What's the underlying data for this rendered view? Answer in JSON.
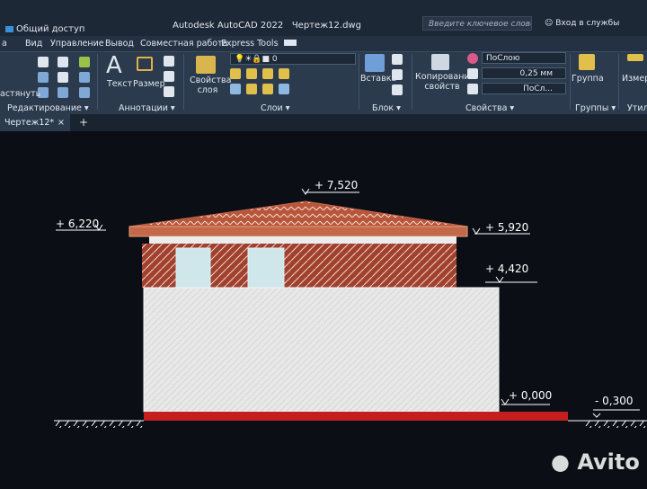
{
  "titlebar": {
    "share_label": "Общий доступ",
    "app_name": "Autodesk AutoCAD 2022",
    "file_name": "Чертеж12.dwg",
    "search_placeholder": "Введите ключевое слово/фразу",
    "signin_label": "Вход в службы"
  },
  "menu": [
    "а",
    "Вид",
    "Управление",
    "Вывод",
    "Совместная работа",
    "Express Tools"
  ],
  "ribbon": {
    "modify": {
      "stretch_label": "астянуть",
      "panel_label": "Редактирование ▾"
    },
    "annotation": {
      "text_label": "Текст",
      "dim_label": "Размер",
      "panel_label": "Аннотации ▾"
    },
    "layers": {
      "props_label": "Свойства слоя",
      "layer_value": "0",
      "panel_label": "Слои ▾"
    },
    "block": {
      "insert_label": "Вставка",
      "panel_label": "Блок ▾"
    },
    "properties": {
      "match_label": "Копирование свойств",
      "color_value": "ПоСлою",
      "lineweight_value": "0,25 мм",
      "linetype_value": "ПоСл...",
      "panel_label": "Свойства ▾"
    },
    "groups": {
      "group_label": "Группа",
      "panel_label": "Группы ▾"
    },
    "measure": {
      "label": "Измер"
    },
    "utilities": {
      "panel_label": "Утили"
    }
  },
  "tabs": {
    "active_label": "Чертеж12*",
    "close_glyph": "×",
    "plus_glyph": "+"
  },
  "drawing": {
    "levels": [
      "+ 7,520",
      "+ 6,220",
      "+ 5,920",
      "+ 4,420",
      "+ 0,000",
      "- 0,300"
    ],
    "colors": {
      "background": "#0b0f15",
      "roof": "#b8553a",
      "upper_wall": "#a0402e",
      "facade": "#e8e8e8",
      "window": "#cfe6ea",
      "base": "#c41e1e",
      "level_line": "#ffffff"
    }
  },
  "watermark": {
    "text": "Avito"
  }
}
